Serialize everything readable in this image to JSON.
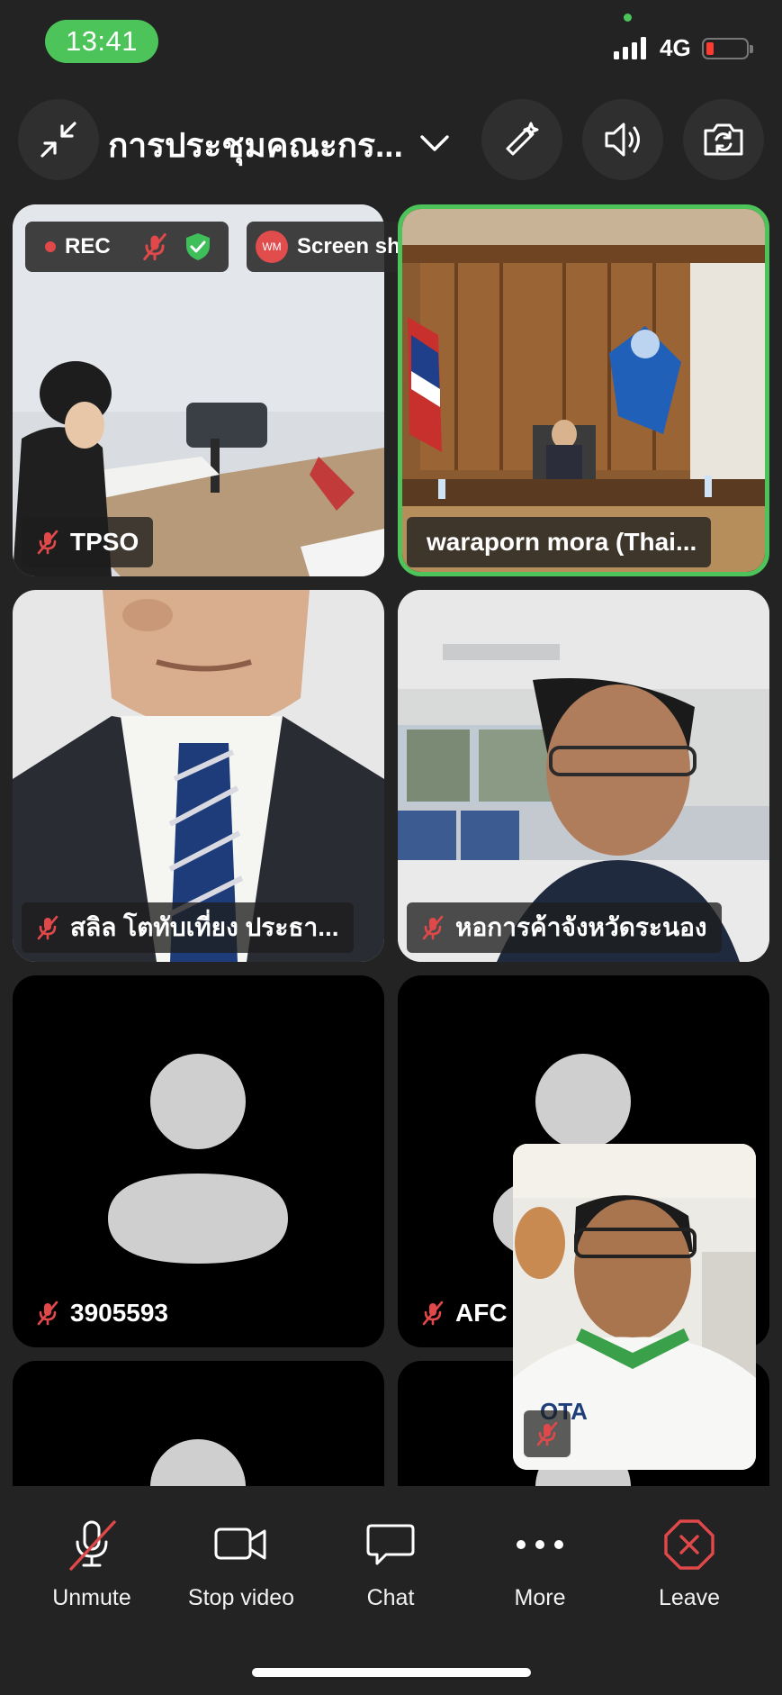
{
  "status_bar": {
    "time": "13:41",
    "network": "4G"
  },
  "meeting": {
    "title": "การประชุมคณะกร..."
  },
  "badges": {
    "rec": "REC",
    "screen_share": "Screen share",
    "share_avatar": "WM"
  },
  "tiles": [
    {
      "name": "TPSO"
    },
    {
      "name": "waraporn mora (Thai..."
    },
    {
      "name": "สลิล โตทับเที่ยง ประธา..."
    },
    {
      "name": "หอการค้าจังหวัดระนอง"
    },
    {
      "name": "3905593"
    },
    {
      "name": "AFC"
    }
  ],
  "self_view": {
    "logo_text": "OTA"
  },
  "toolbar": {
    "unmute": "Unmute",
    "stop_video": "Stop video",
    "chat": "Chat",
    "more": "More",
    "leave": "Leave"
  },
  "colors": {
    "active_speaker": "#4cc45a",
    "muted": "#e0484a",
    "leave": "#e0484a"
  }
}
